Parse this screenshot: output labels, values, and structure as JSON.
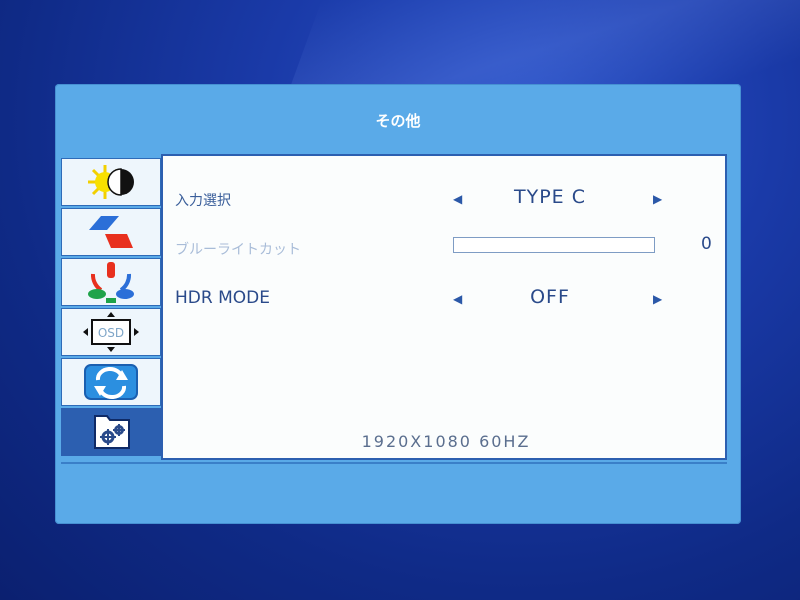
{
  "osd": {
    "title": "その他",
    "tabs": [
      {
        "name": "brightness-contrast",
        "icon": "brightness-contrast-icon"
      },
      {
        "name": "image",
        "icon": "image-settings-icon"
      },
      {
        "name": "color",
        "icon": "color-rgb-icon"
      },
      {
        "name": "osd",
        "icon": "osd-position-icon"
      },
      {
        "name": "reset",
        "icon": "reset-icon"
      },
      {
        "name": "other",
        "icon": "gear-icon",
        "active": true
      }
    ],
    "rows": [
      {
        "label": "入力選択",
        "value": "TYPE  C"
      },
      {
        "label": "ブルーライトカット",
        "value": "0",
        "level": 0
      },
      {
        "label": "HDR  MODE",
        "value": "OFF"
      }
    ],
    "arrows": {
      "left": "◀",
      "right": "▶"
    },
    "resolution": "1920X1080  60HZ"
  },
  "colors": {
    "osd_bg": "#5aaae8",
    "accent": "#2c5fb0",
    "text": "#2a4a8a"
  }
}
